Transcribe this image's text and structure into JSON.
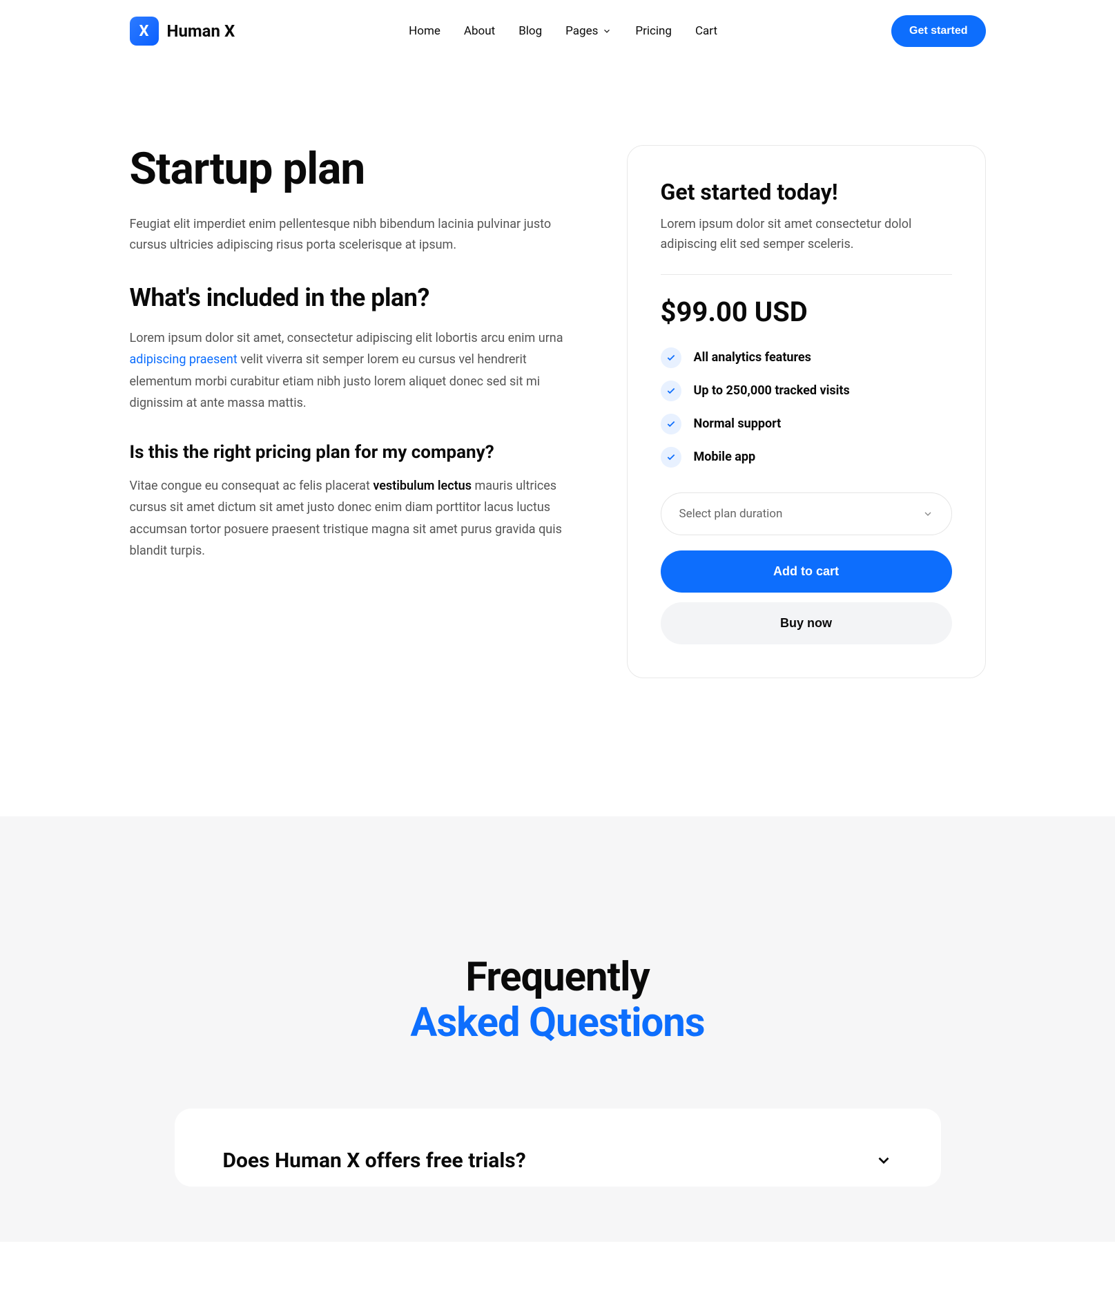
{
  "header": {
    "brand": "Human X",
    "nav": [
      "Home",
      "About",
      "Blog",
      "Pages",
      "Pricing",
      "Cart"
    ],
    "cta": "Get started"
  },
  "plan": {
    "title": "Startup plan",
    "intro": "Feugiat elit imperdiet enim pellentesque nibh bibendum lacinia pulvinar justo cursus ultricies adipiscing risus porta scelerisque at ipsum.",
    "h2": "What's included in the plan?",
    "p1a": "Lorem ipsum dolor sit amet, consectetur adipiscing elit lobortis arcu enim urna ",
    "p1link": "adipiscing praesent",
    "p1b": " velit viverra sit semper lorem eu cursus vel hendrerit elementum morbi curabitur etiam nibh justo lorem aliquet donec sed sit mi dignissim at ante massa mattis.",
    "h3": "Is this the right pricing plan for my company?",
    "p2a": "Vitae congue eu consequat ac felis placerat ",
    "p2s": "vestibulum lectus",
    "p2b": " mauris ultrices cursus sit amet dictum sit amet justo donec enim diam porttitor lacus luctus accumsan tortor posuere praesent tristique magna sit amet purus gravida quis blandit turpis."
  },
  "card": {
    "title": "Get started today!",
    "desc": "Lorem ipsum dolor sit amet consectetur dolol adipiscing elit sed semper sceleris.",
    "price": "$99.00 USD",
    "features": [
      "All analytics features",
      "Up to 250,000 tracked visits",
      "Normal support",
      "Mobile app"
    ],
    "selectPlaceholder": "Select plan duration",
    "addCart": "Add to cart",
    "buyNow": "Buy now"
  },
  "faq": {
    "title1": "Frequently",
    "title2": "Asked Questions",
    "q1": "Does Human X offers free trials?"
  }
}
